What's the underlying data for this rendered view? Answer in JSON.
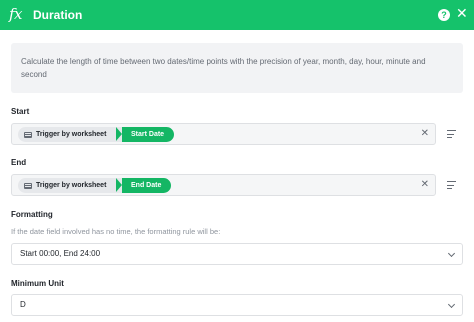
{
  "header": {
    "icon": "fx-icon",
    "title": "Duration",
    "help_icon": "question-icon",
    "close_icon": "close-icon",
    "color": "#15c26b"
  },
  "description": "Calculate the length of time between two dates/time points with the precision of year, month, day, hour, minute and second",
  "start": {
    "label": "Start",
    "source_chip": "Trigger by worksheet",
    "field_chip": "Start Date"
  },
  "end": {
    "label": "End",
    "source_chip": "Trigger by worksheet",
    "field_chip": "End Date"
  },
  "formatting": {
    "label": "Formatting",
    "hint": "If the date field involved has no time, the formatting rule will be:",
    "value": "Start 00:00, End 24:00"
  },
  "minimum_unit": {
    "label": "Minimum Unit",
    "value": "D"
  }
}
